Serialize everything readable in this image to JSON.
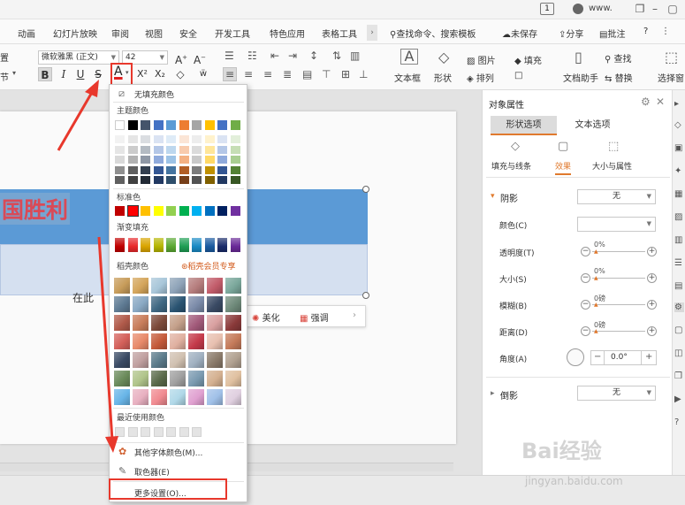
{
  "titlebar": {
    "tab_count": "1",
    "user": "www."
  },
  "menu": {
    "tabs": [
      "动画",
      "幻灯片放映",
      "审阅",
      "视图",
      "安全",
      "开发工具",
      "特色应用",
      "表格工具"
    ],
    "active_tab": "表格工具",
    "search": "查找命令、搜索模板",
    "unsaved": "未保存",
    "share": "分享",
    "annotate": "批注",
    "help": "?"
  },
  "toolbar": {
    "font_name": "微软雅黑 (正文)",
    "font_size": "42",
    "left_label_1": "置",
    "left_label_2": "节",
    "textbox": "文本框",
    "shape": "形状",
    "picture": "图片",
    "fill": "填充",
    "arrange": "排列",
    "outline": "",
    "doc_helper": "文档助手",
    "find": "查找",
    "replace": "替换",
    "select": "选择窗"
  },
  "slide": {
    "title": "国胜利",
    "subtitle": "在此",
    "mini_toolbar": {
      "beautify": "美化",
      "emphasis": "强调"
    }
  },
  "color_menu": {
    "no_fill": "无填充颜色",
    "theme_colors": "主题颜色",
    "standard_colors": "标准色",
    "gradient_fill": "渐变填充",
    "shell_colors": "稻壳颜色",
    "shell_vip": "稻壳会员专享",
    "recent_colors": "最近使用颜色",
    "other_font_colors": "其他字体颜色(M)...",
    "eyedropper": "取色器(E)",
    "more_settings": "更多设置(O)...",
    "theme_top": [
      "#ffffff",
      "#000000",
      "#44546a",
      "#4472c4",
      "#5b9bd5",
      "#ed7d31",
      "#a5a5a5",
      "#ffc000",
      "#4472c4",
      "#70ad47"
    ],
    "standard": [
      "#c00000",
      "#ff0000",
      "#ffc000",
      "#ffff00",
      "#92d050",
      "#00b050",
      "#00b0f0",
      "#0070c0",
      "#002060",
      "#7030a0"
    ],
    "gradient": [
      "#c00000",
      "#e8292c",
      "#d9a400",
      "#b5b500",
      "#5aa832",
      "#1f9e54",
      "#1a8ac4",
      "#1a5aa0",
      "#1a2c6a",
      "#6a2a98"
    ]
  },
  "prop_pane": {
    "title": "对象属性",
    "tab_shape": "形状选项",
    "tab_text": "文本选项",
    "sub_fill": "填充与线条",
    "sub_effect": "效果",
    "sub_size": "大小与属性",
    "shadow": "阴影",
    "shadow_value": "无",
    "color": "颜色(C)",
    "transparency": "透明度(T)",
    "transparency_value": "0%",
    "size": "大小(S)",
    "size_value": "0%",
    "blur": "模糊(B)",
    "blur_value": "0磅",
    "distance": "距离(D)",
    "distance_value": "0磅",
    "angle": "角度(A)",
    "angle_value": "0.0°",
    "reflection": "倒影",
    "reflection_value": "无"
  },
  "watermark": {
    "brand": "Bai经验",
    "url": "jingyan.baidu.com"
  }
}
